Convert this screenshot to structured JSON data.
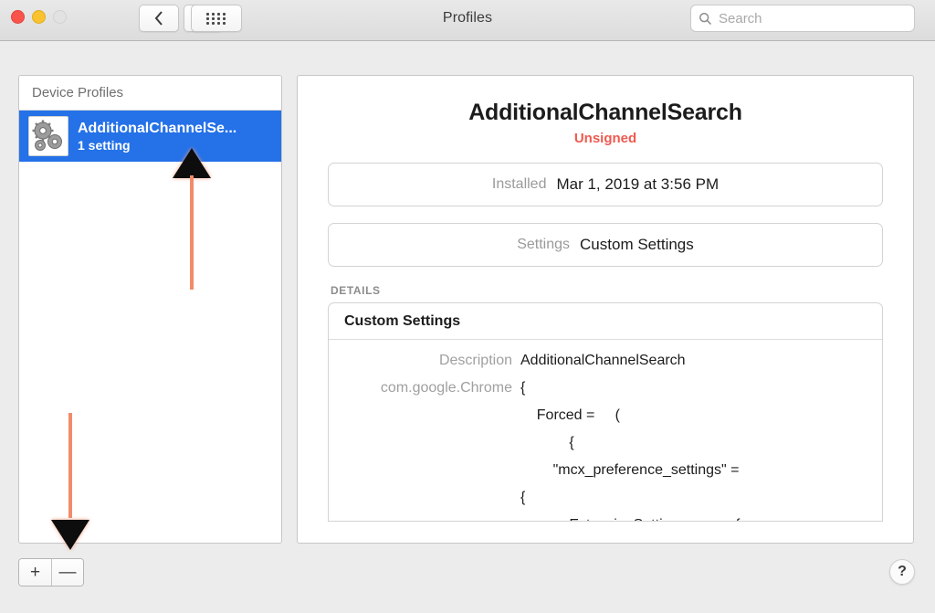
{
  "window": {
    "title": "Profiles",
    "traffic_lights": [
      "close",
      "minimize",
      "zoom"
    ],
    "back_icon": "chevron-left-icon",
    "forward_icon": "chevron-right-icon",
    "grid_icon": "show-all-grid-icon"
  },
  "search": {
    "placeholder": "Search",
    "icon": "search-icon",
    "value": ""
  },
  "sidebar": {
    "header": "Device Profiles",
    "items": [
      {
        "name": "AdditionalChannelSe...",
        "subtitle": "1 setting",
        "icon": "profile-gears-icon",
        "selected": true
      }
    ],
    "add_label": "+",
    "remove_label": "—"
  },
  "main": {
    "title": "AdditionalChannelSearch",
    "signature_status": "Unsigned",
    "fields": [
      {
        "label": "Installed",
        "value": "Mar 1, 2019 at 3:56 PM"
      },
      {
        "label": "Settings",
        "value": "Custom Settings"
      }
    ],
    "details_caption": "DETAILS",
    "details_title": "Custom Settings",
    "plist_rows": [
      {
        "key": "Description",
        "value": "AdditionalChannelSearch"
      },
      {
        "key": "com.google.Chrome",
        "value": "{"
      },
      {
        "key": "",
        "value": "    Forced =     ("
      },
      {
        "key": "",
        "value": "            {"
      },
      {
        "key": "",
        "value": "        \"mcx_preference_settings\" ="
      },
      {
        "key": "",
        "value": "{"
      },
      {
        "key": "",
        "value": "            ExtensionSettings =         {"
      }
    ]
  },
  "footer": {
    "help_label": "?",
    "help_icon": "help-question-icon"
  },
  "annotations": [
    {
      "name": "arrow-to-profile-row",
      "direction": "up",
      "color": "#f28b6b"
    },
    {
      "name": "arrow-to-remove-button",
      "direction": "down",
      "color": "#f28b6b"
    }
  ],
  "colors": {
    "selection_blue": "#2471e8",
    "unsigned_red": "#f0594f",
    "annotation": "#f28b6b"
  }
}
